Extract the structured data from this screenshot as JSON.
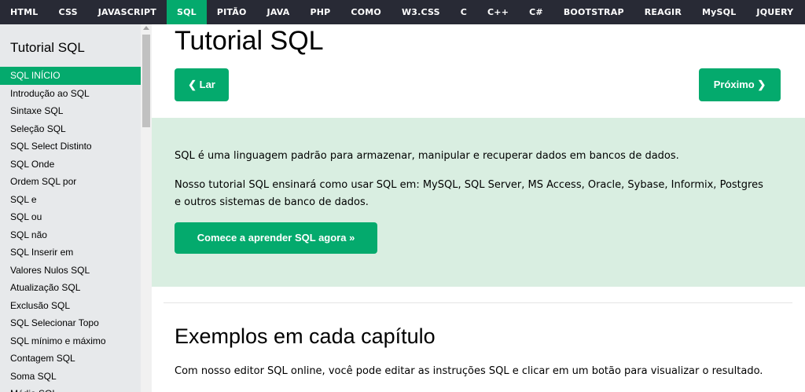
{
  "topnav": {
    "items": [
      "HTML",
      "CSS",
      "JAVASCRIPT",
      "SQL",
      "PITÃO",
      "JAVA",
      "PHP",
      "COMO",
      "W3.CSS",
      "C",
      "C++",
      "C#",
      "BOOTSTRAP",
      "REAGIR",
      "MySQL",
      "JQUERY"
    ],
    "active_index": 3
  },
  "sidebar": {
    "heading": "Tutorial SQL",
    "items": [
      "SQL INÍCIO",
      "Introdução ao SQL",
      "Sintaxe SQL",
      "Seleção SQL",
      "SQL Select Distinto",
      "SQL Onde",
      "Ordem SQL por",
      "SQL e",
      "SQL ou",
      "SQL não",
      "SQL Inserir em",
      "Valores Nulos SQL",
      "Atualização SQL",
      "Exclusão SQL",
      "SQL Selecionar Topo",
      "SQL mínimo e máximo",
      "Contagem SQL",
      "Soma SQL",
      "Média SQL"
    ],
    "active_index": 0
  },
  "main": {
    "title": "Tutorial SQL",
    "prev_label": "❮ Lar",
    "next_label": "Próximo ❯",
    "intro_1": "SQL é uma linguagem padrão para armazenar, manipular e recuperar dados em bancos de dados.",
    "intro_2": "Nosso tutorial SQL ensinará como usar SQL em: MySQL, SQL Server, MS Access, Oracle, Sybase, Informix, Postgres e outros sistemas de banco de dados.",
    "start_label": "Comece a aprender SQL agora »",
    "examples_heading": "Exemplos em cada capítulo",
    "examples_text": "Com nosso editor SQL online, você pode editar as instruções SQL e clicar em um botão para visualizar o resultado."
  },
  "colors": {
    "nav_bg": "#282a35",
    "accent": "#04aa6d",
    "sidebar_bg": "#e7e9eb",
    "panel_bg": "#d9eee1"
  }
}
